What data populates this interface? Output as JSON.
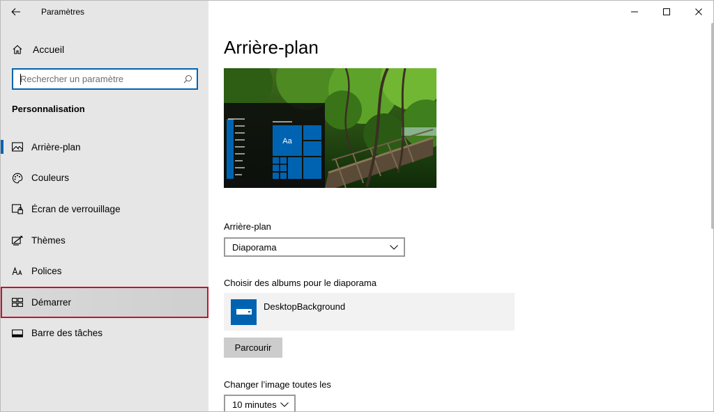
{
  "window": {
    "app_title": "Paramètres",
    "controls": {
      "minimize": "minimize-icon",
      "maximize": "maximize-icon",
      "close": "close-icon"
    }
  },
  "sidebar": {
    "home_label": "Accueil",
    "search_placeholder": "Rechercher un paramètre",
    "search_value": "",
    "section_title": "Personnalisation",
    "items": [
      {
        "label": "Arrière-plan",
        "icon": "picture-icon",
        "active": true
      },
      {
        "label": "Couleurs",
        "icon": "palette-icon",
        "active": false
      },
      {
        "label": "Écran de verrouillage",
        "icon": "lock-screen-icon",
        "active": false
      },
      {
        "label": "Thèmes",
        "icon": "themes-icon",
        "active": false
      },
      {
        "label": "Polices",
        "icon": "fonts-icon",
        "active": false
      },
      {
        "label": "Démarrer",
        "icon": "start-icon",
        "active": false,
        "highlighted": true
      },
      {
        "label": "Barre des tâches",
        "icon": "taskbar-icon",
        "active": false
      }
    ]
  },
  "main": {
    "page_title": "Arrière-plan",
    "preview": {
      "tile_text": "Aa"
    },
    "background_label": "Arrière-plan",
    "background_value": "Diaporama",
    "albums_label": "Choisir des albums pour le diaporama",
    "album_name": "DesktopBackground",
    "browse_label": "Parcourir",
    "interval_label": "Changer l’image toutes les",
    "interval_value": "10 minutes"
  },
  "colors": {
    "accent": "#0063b1",
    "sidebar_bg": "#e6e6e6",
    "highlight_border": "#c8102e"
  }
}
